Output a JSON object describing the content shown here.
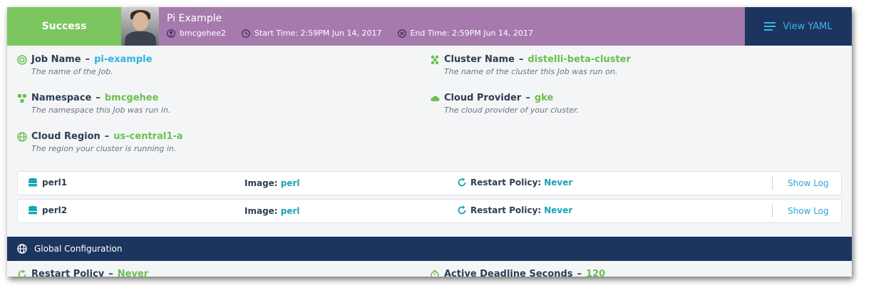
{
  "header": {
    "status": "Success",
    "title": "Pi Example",
    "user": "bmcgehee2",
    "start_time": "Start Time: 2:59PM Jun 14, 2017",
    "end_time": "End Time: 2:59PM Jun 14, 2017",
    "view_yaml": "View YAML"
  },
  "fields": {
    "job_name": {
      "label": "Job Name",
      "value": "pi-example",
      "desc": "The name of the Job.",
      "icon": "job-icon"
    },
    "cluster_name": {
      "label": "Cluster Name",
      "value": "distelli-beta-cluster",
      "desc": "The name of the cluster this Job was run on.",
      "icon": "cluster-icon"
    },
    "namespace": {
      "label": "Namespace",
      "value": "bmcgehee",
      "desc": "The namespace this Job was run in.",
      "icon": "namespace-icon"
    },
    "cloud_provider": {
      "label": "Cloud Provider",
      "value": "gke",
      "desc": "The cloud provider of your cluster.",
      "icon": "cloud-icon"
    },
    "cloud_region": {
      "label": "Cloud Region",
      "value": "us-central1-a",
      "desc": "The region your cluster is running in.",
      "icon": "globe-icon"
    }
  },
  "containers": [
    {
      "name": "perl1",
      "image_label": "Image:",
      "image": "perl",
      "rp_label": "Restart Policy:",
      "rp": "Never",
      "log": "Show Log"
    },
    {
      "name": "perl2",
      "image_label": "Image:",
      "image": "perl",
      "rp_label": "Restart Policy:",
      "rp": "Never",
      "log": "Show Log"
    }
  ],
  "global": {
    "title": "Global Configuration",
    "restart_policy_label": "Restart Policy",
    "restart_policy_value": "Never",
    "deadline_label": "Active Deadline Seconds",
    "deadline_value": "120"
  },
  "colors": {
    "success": "#7cc660",
    "header_purple": "#a77aad",
    "navy": "#1c355e",
    "green_value": "#6bbf4e",
    "cyan_value": "#2fb3d9"
  }
}
